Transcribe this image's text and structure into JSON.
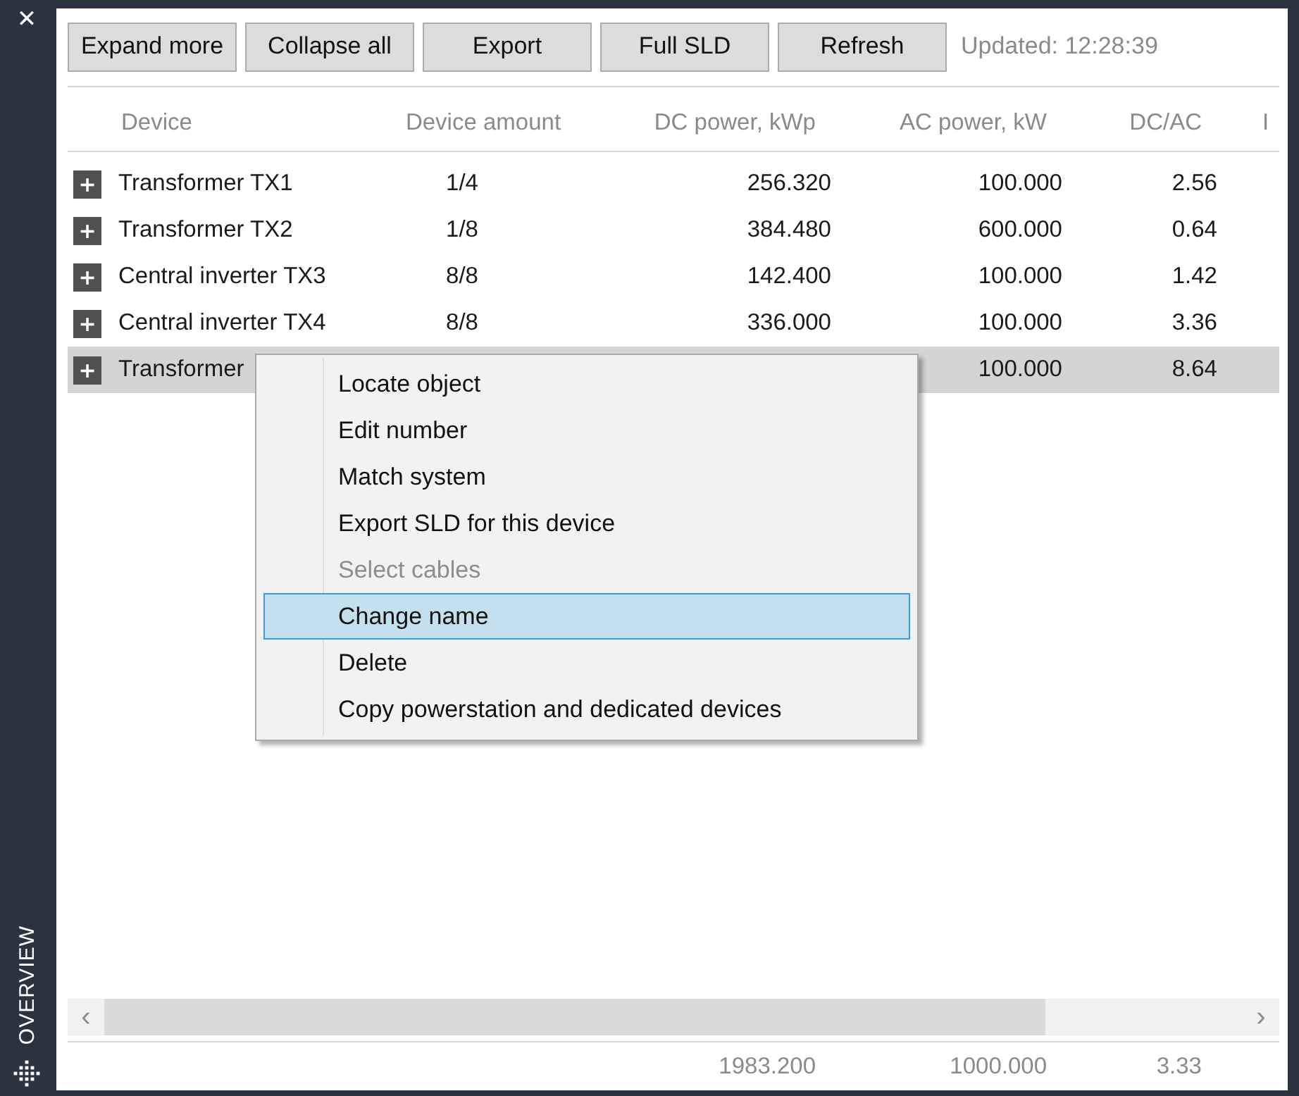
{
  "sidebar": {
    "close_glyph": "✕",
    "title": "OVERVIEW"
  },
  "toolbar": {
    "buttons": [
      "Expand more",
      "Collapse all",
      "Export",
      "Full SLD",
      "Refresh"
    ],
    "updated": "Updated: 12:28:39"
  },
  "table": {
    "columns": [
      "Device",
      "Device amount",
      "DC power, kWp",
      "AC power, kW",
      "DC/AC",
      "I"
    ],
    "rows": [
      {
        "expand_glyph": "+",
        "device": "Transformer TX1",
        "amount": "1/4",
        "dc_power": "256.320",
        "ac_power": "100.000",
        "dc_ac": "2.56",
        "selected": false
      },
      {
        "expand_glyph": "+",
        "device": "Transformer TX2",
        "amount": "1/8",
        "dc_power": "384.480",
        "ac_power": "600.000",
        "dc_ac": "0.64",
        "selected": false
      },
      {
        "expand_glyph": "+",
        "device": "Central inverter TX3",
        "amount": "8/8",
        "dc_power": "142.400",
        "ac_power": "100.000",
        "dc_ac": "1.42",
        "selected": false
      },
      {
        "expand_glyph": "+",
        "device": "Central inverter TX4",
        "amount": "8/8",
        "dc_power": "336.000",
        "ac_power": "100.000",
        "dc_ac": "3.36",
        "selected": false
      },
      {
        "expand_glyph": "+",
        "device": "Transformer",
        "ac_power": "100.000",
        "dc_ac": "8.64",
        "selected": true
      }
    ],
    "scrollbar": {
      "left_glyph": "‹",
      "right_glyph": "›"
    },
    "totals": {
      "dc_power": "1983.200",
      "ac_power": "1000.000",
      "dc_ac": "3.33"
    }
  },
  "context_menu": {
    "items": [
      {
        "label": "Locate object",
        "disabled": false,
        "selected": false
      },
      {
        "label": "Edit number",
        "disabled": false,
        "selected": false
      },
      {
        "label": "Match system",
        "disabled": false,
        "selected": false
      },
      {
        "label": "Export SLD for this device",
        "disabled": false,
        "selected": false
      },
      {
        "label": "Select cables",
        "disabled": true,
        "selected": false
      },
      {
        "label": "Change name",
        "disabled": false,
        "selected": true
      },
      {
        "label": "Delete",
        "disabled": false,
        "selected": false
      },
      {
        "label": "Copy powerstation and dedicated devices",
        "disabled": false,
        "selected": false
      }
    ]
  }
}
